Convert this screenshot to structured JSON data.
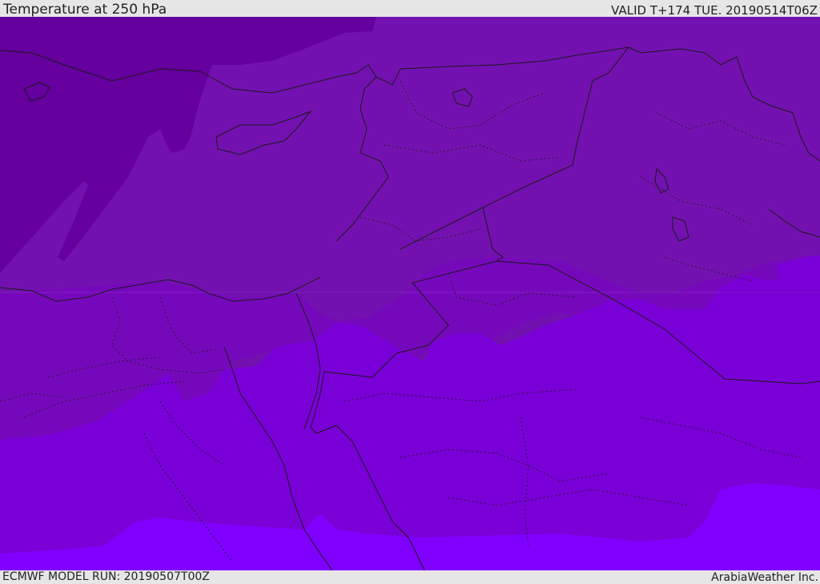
{
  "header": {
    "title": "Temperature at 250 hPa",
    "valid": "VALID T+174 TUE. 20190514T06Z"
  },
  "footer": {
    "model_run": "ECMWF MODEL RUN: 20190507T00Z",
    "brand": "ArabiaWeather Inc."
  },
  "map": {
    "variable": "temperature",
    "level": "250 hPa",
    "colors": {
      "coldest": "#65009f",
      "cold": "#7311b0",
      "mid": "#7608bc",
      "warm": "#7a00d8",
      "warmest": "#8000ff",
      "coast": "#1a1a1a"
    }
  }
}
